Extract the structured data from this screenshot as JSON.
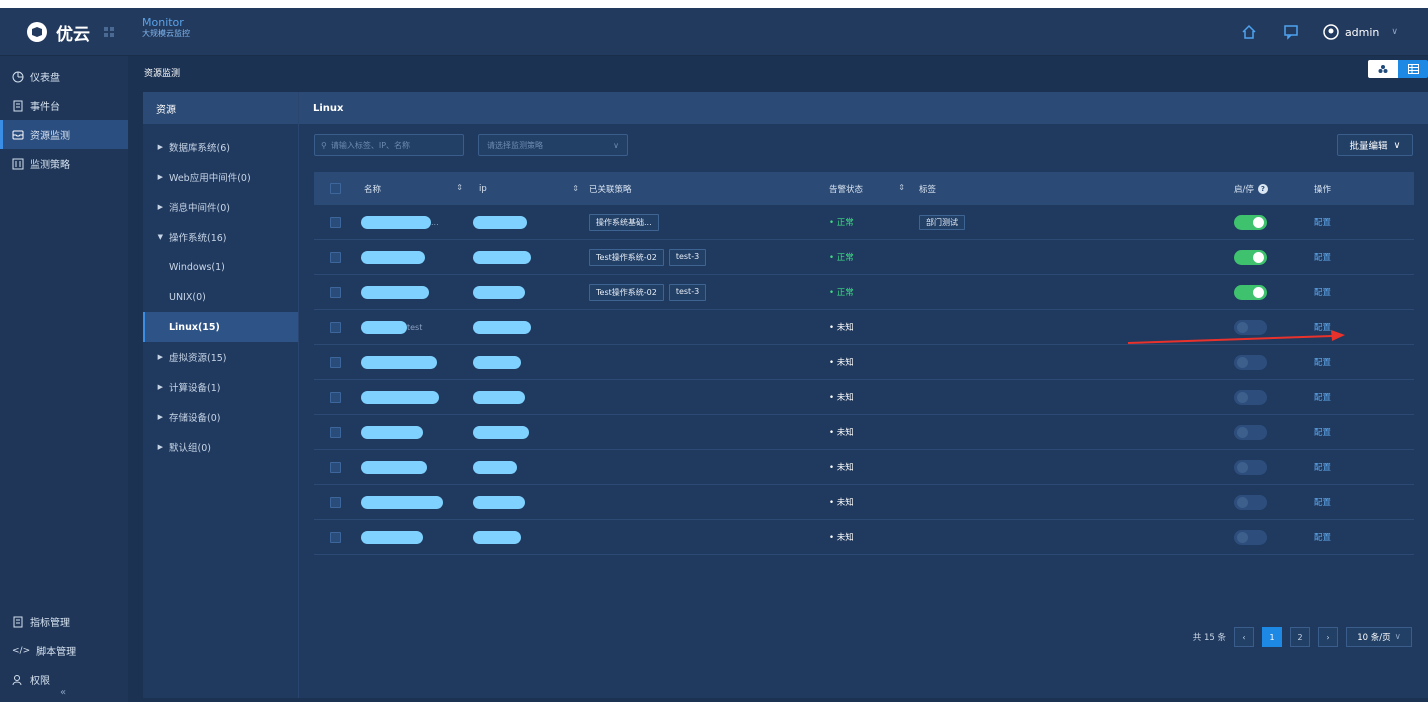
{
  "header": {
    "logo_text": "优云",
    "brand_title": "Monitor",
    "brand_sub": "大规模云监控",
    "user": "admin"
  },
  "sidebar": {
    "items": [
      {
        "label": "仪表盘"
      },
      {
        "label": "事件台"
      },
      {
        "label": "资源监测"
      },
      {
        "label": "监测策略"
      }
    ],
    "bottom": [
      {
        "label": "指标管理"
      },
      {
        "label": "脚本管理"
      },
      {
        "label": "权限"
      }
    ]
  },
  "page": {
    "title": "资源监测"
  },
  "resources": {
    "header": "资源",
    "tree": [
      {
        "label": "数据库系统(6)"
      },
      {
        "label": "Web应用中间件(0)"
      },
      {
        "label": "消息中间件(0)"
      },
      {
        "label": "操作系统(16)"
      },
      {
        "label": "Windows(1)"
      },
      {
        "label": "UNIX(0)"
      },
      {
        "label": "Linux(15)"
      },
      {
        "label": "虚拟资源(15)"
      },
      {
        "label": "计算设备(1)"
      },
      {
        "label": "存储设备(0)"
      },
      {
        "label": "默认组(0)"
      }
    ]
  },
  "content": {
    "title": "Linux",
    "search_placeholder": "请输入标签、IP、名称",
    "policy_placeholder": "请选择监测策略",
    "batch_label": "批量编辑",
    "columns": {
      "name": "名称",
      "ip": "ip",
      "policy": "已关联策略",
      "status": "告警状态",
      "tags": "标签",
      "enable": "启/停",
      "action": "操作"
    },
    "rows": [
      {
        "name_suffix": "...",
        "policies": [
          "操作系统基础..."
        ],
        "status": "• 正常",
        "status_ok": true,
        "tag": "部门测试",
        "enabled": true,
        "action": "配置"
      },
      {
        "name_suffix": "",
        "policies": [
          "Test操作系统-02",
          "test-3"
        ],
        "status": "• 正常",
        "status_ok": true,
        "tag": "",
        "enabled": true,
        "action": "配置"
      },
      {
        "name_suffix": "",
        "policies": [
          "Test操作系统-02",
          "test-3"
        ],
        "status": "• 正常",
        "status_ok": true,
        "tag": "",
        "enabled": true,
        "action": "配置"
      },
      {
        "name_suffix": "test",
        "policies": [],
        "status": "• 未知",
        "status_ok": false,
        "tag": "",
        "enabled": false,
        "action": "配置"
      },
      {
        "name_suffix": "",
        "policies": [],
        "status": "• 未知",
        "status_ok": false,
        "tag": "",
        "enabled": false,
        "action": "配置"
      },
      {
        "name_suffix": "",
        "policies": [],
        "status": "• 未知",
        "status_ok": false,
        "tag": "",
        "enabled": false,
        "action": "配置"
      },
      {
        "name_suffix": "",
        "policies": [],
        "status": "• 未知",
        "status_ok": false,
        "tag": "",
        "enabled": false,
        "action": "配置"
      },
      {
        "name_suffix": "",
        "policies": [],
        "status": "• 未知",
        "status_ok": false,
        "tag": "",
        "enabled": false,
        "action": "配置"
      },
      {
        "name_suffix": "",
        "policies": [],
        "status": "• 未知",
        "status_ok": false,
        "tag": "",
        "enabled": false,
        "action": "配置"
      },
      {
        "name_suffix": "",
        "policies": [],
        "status": "• 未知",
        "status_ok": false,
        "tag": "",
        "enabled": false,
        "action": "配置"
      }
    ],
    "pagination": {
      "total": "共 15 条",
      "page1": "1",
      "page2": "2",
      "per_page": "10 条/页"
    }
  },
  "colors": {
    "accent": "#1e88e5",
    "ok": "#3ddc84",
    "toggle_on": "#3ec26d",
    "arrow": "#e8322b"
  }
}
